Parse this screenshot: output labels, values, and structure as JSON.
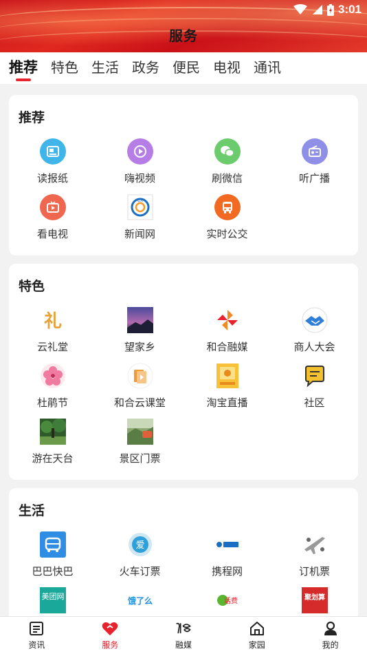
{
  "status": {
    "time": "3:01"
  },
  "header": {
    "title": "服务"
  },
  "tabs": [
    {
      "label": "推荐",
      "active": true
    },
    {
      "label": "特色"
    },
    {
      "label": "生活"
    },
    {
      "label": "政务"
    },
    {
      "label": "便民"
    },
    {
      "label": "电视"
    },
    {
      "label": "通讯"
    }
  ],
  "sections": {
    "recommend": {
      "title": "推荐",
      "items": [
        {
          "label": "读报纸",
          "icon": "newspaper-icon",
          "color": "#3fb5ea"
        },
        {
          "label": "嗨视频",
          "icon": "play-video-icon",
          "color": "#b77de6"
        },
        {
          "label": "刷微信",
          "icon": "wechat-icon",
          "color": "#6ccb6c"
        },
        {
          "label": "听广播",
          "icon": "radio-icon",
          "color": "#8f8fe8"
        },
        {
          "label": "看电视",
          "icon": "tv-icon",
          "color": "#f0674f"
        },
        {
          "label": "新闻网",
          "icon": "news-site-logo-icon",
          "color": "#1d6fc2"
        },
        {
          "label": "实时公交",
          "icon": "bus-icon",
          "color": "#f26a21"
        }
      ]
    },
    "featured": {
      "title": "特色",
      "items": [
        {
          "label": "云礼堂",
          "icon": "cloud-hall-icon",
          "color": "#e8a23a"
        },
        {
          "label": "望家乡",
          "icon": "hometown-photo-icon",
          "color": "#5a5aa8"
        },
        {
          "label": "和合融媒",
          "icon": "pinwheel-logo-icon",
          "color": "#f08a24"
        },
        {
          "label": "商人大会",
          "icon": "handshake-icon",
          "color": "#2f7fd8"
        },
        {
          "label": "杜鹃节",
          "icon": "azalea-flower-icon",
          "color": "#f07aa0"
        },
        {
          "label": "和合云课堂",
          "icon": "cloud-class-icon",
          "color": "#f29a3a"
        },
        {
          "label": "淘宝直播",
          "icon": "taobao-live-icon",
          "color": "#f7c23a"
        },
        {
          "label": "社区",
          "icon": "community-chat-icon",
          "color": "#f3c02e"
        },
        {
          "label": "游在天台",
          "icon": "tiantai-travel-photo-icon",
          "color": "#3f7d3a"
        },
        {
          "label": "景区门票",
          "icon": "scenic-ticket-photo-icon",
          "color": "#6a8f55"
        }
      ]
    },
    "life": {
      "title": "生活",
      "items": [
        {
          "label": "巴巴快巴",
          "icon": "bus-express-icon",
          "color": "#2f8ee3"
        },
        {
          "label": "火车订票",
          "icon": "train-ticket-icon",
          "color": "#2fa0d8"
        },
        {
          "label": "携程网",
          "icon": "ctrip-logo-icon",
          "color": "#1a6fc4"
        },
        {
          "label": "订机票",
          "icon": "airplane-icon",
          "color": "#888888"
        },
        {
          "label": "",
          "icon": "meituan-logo-icon",
          "color": "#19a89a",
          "logo_text": "美团网"
        },
        {
          "label": "",
          "icon": "eleme-logo-icon",
          "color": "#1d8fe3",
          "logo_text": "饿了么"
        },
        {
          "label": "",
          "icon": "phone-recharge-logo-icon",
          "color": "#5cb531",
          "logo_text": "话费"
        },
        {
          "label": "",
          "icon": "juhuasuan-logo-icon",
          "color": "#d62b2b",
          "logo_text": "聚划算"
        }
      ]
    }
  },
  "bottom_nav": [
    {
      "label": "资讯",
      "icon": "news-icon"
    },
    {
      "label": "服务",
      "icon": "service-heart-icon",
      "active": true
    },
    {
      "label": "融媒",
      "icon": "media-logo-icon"
    },
    {
      "label": "家园",
      "icon": "home-icon"
    },
    {
      "label": "我的",
      "icon": "profile-icon"
    }
  ]
}
